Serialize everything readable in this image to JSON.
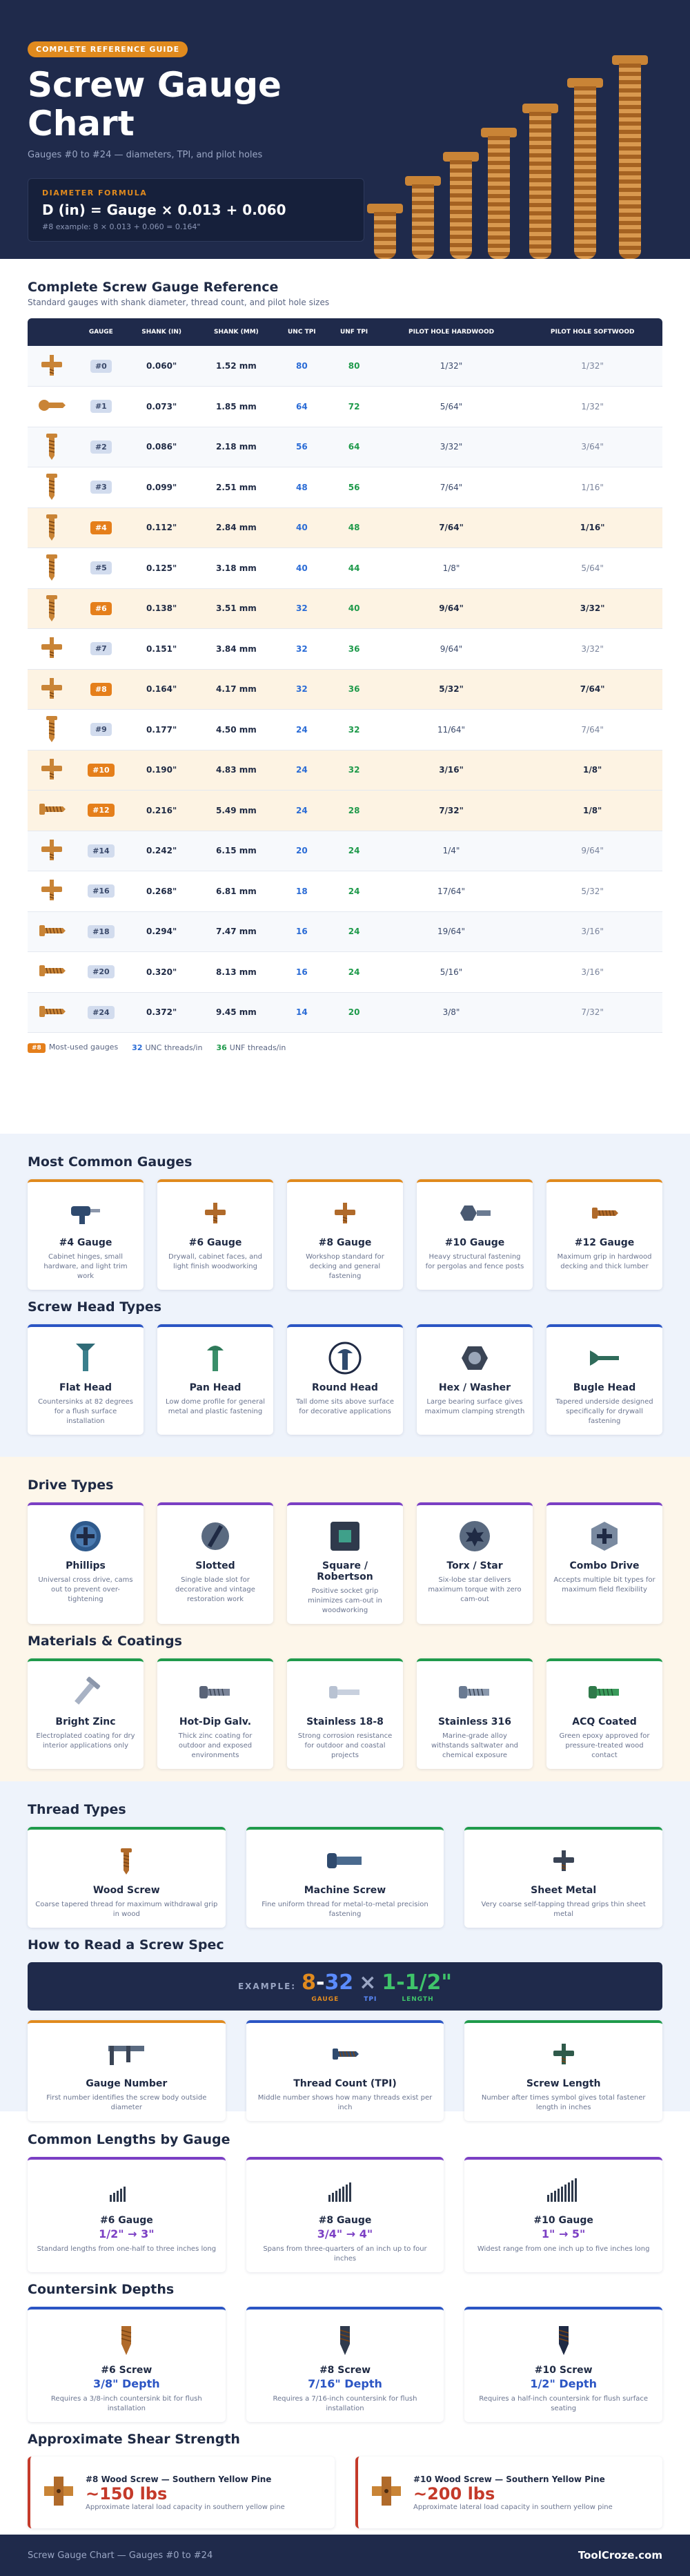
{
  "hero": {
    "tag": "COMPLETE REFERENCE GUIDE",
    "title": "Screw Gauge Chart",
    "subtitle": "Gauges #0 to #24 — diameters, TPI, and pilot holes",
    "formula_label": "DIAMETER FORMULA",
    "formula": "D (in) = Gauge × 0.013 + 0.060",
    "formula_example": "#8 example: 8 × 0.013 + 0.060 = 0.164\""
  },
  "table": {
    "title": "Complete Screw Gauge Reference",
    "subtitle": "Standard gauges with shank diameter, thread count, and pilot hole sizes",
    "headers": [
      "",
      "GAUGE",
      "SHANK (IN)",
      "SHANK (MM)",
      "UNC TPI",
      "UNF TPI",
      "PILOT HOLE HARDWOOD",
      "PILOT HOLE SOFTWOOD"
    ],
    "rows": [
      {
        "g": "#0",
        "in": "0.060\"",
        "mm": "1.52 mm",
        "unc": "80",
        "unf": "80",
        "hw": "1/32\"",
        "sw": "1/32\"",
        "hl": false,
        "icon": "phillips-screw"
      },
      {
        "g": "#1",
        "in": "0.073\"",
        "mm": "1.85 mm",
        "unc": "64",
        "unf": "72",
        "hw": "5/64\"",
        "sw": "1/32\"",
        "hl": false,
        "icon": "round-screw"
      },
      {
        "g": "#2",
        "in": "0.086\"",
        "mm": "2.18 mm",
        "unc": "56",
        "unf": "64",
        "hw": "3/32\"",
        "sw": "3/64\"",
        "hl": false,
        "icon": "wood-screw"
      },
      {
        "g": "#3",
        "in": "0.099\"",
        "mm": "2.51 mm",
        "unc": "48",
        "unf": "56",
        "hw": "7/64\"",
        "sw": "1/16\"",
        "hl": false,
        "icon": "wood-screw"
      },
      {
        "g": "#4",
        "in": "0.112\"",
        "mm": "2.84 mm",
        "unc": "40",
        "unf": "48",
        "hw": "7/64\"",
        "sw": "1/16\"",
        "hl": true,
        "icon": "wood-screw"
      },
      {
        "g": "#5",
        "in": "0.125\"",
        "mm": "3.18 mm",
        "unc": "40",
        "unf": "44",
        "hw": "1/8\"",
        "sw": "5/64\"",
        "hl": false,
        "icon": "wood-screw"
      },
      {
        "g": "#6",
        "in": "0.138\"",
        "mm": "3.51 mm",
        "unc": "32",
        "unf": "40",
        "hw": "9/64\"",
        "sw": "3/32\"",
        "hl": true,
        "icon": "wood-screw"
      },
      {
        "g": "#7",
        "in": "0.151\"",
        "mm": "3.84 mm",
        "unc": "32",
        "unf": "36",
        "hw": "9/64\"",
        "sw": "3/32\"",
        "hl": false,
        "icon": "phillips-screw"
      },
      {
        "g": "#8",
        "in": "0.164\"",
        "mm": "4.17 mm",
        "unc": "32",
        "unf": "36",
        "hw": "5/32\"",
        "sw": "7/64\"",
        "hl": true,
        "icon": "phillips-screw"
      },
      {
        "g": "#9",
        "in": "0.177\"",
        "mm": "4.50 mm",
        "unc": "24",
        "unf": "32",
        "hw": "11/64\"",
        "sw": "7/64\"",
        "hl": false,
        "icon": "wood-screw"
      },
      {
        "g": "#10",
        "in": "0.190\"",
        "mm": "4.83 mm",
        "unc": "24",
        "unf": "32",
        "hw": "3/16\"",
        "sw": "1/8\"",
        "hl": true,
        "icon": "phillips-screw"
      },
      {
        "g": "#12",
        "in": "0.216\"",
        "mm": "5.49 mm",
        "unc": "24",
        "unf": "28",
        "hw": "7/32\"",
        "sw": "1/8\"",
        "hl": true,
        "icon": "side-screw"
      },
      {
        "g": "#14",
        "in": "0.242\"",
        "mm": "6.15 mm",
        "unc": "20",
        "unf": "24",
        "hw": "1/4\"",
        "sw": "9/64\"",
        "hl": false,
        "icon": "phillips-screw"
      },
      {
        "g": "#16",
        "in": "0.268\"",
        "mm": "6.81 mm",
        "unc": "18",
        "unf": "24",
        "hw": "17/64\"",
        "sw": "5/32\"",
        "hl": false,
        "icon": "phillips-screw"
      },
      {
        "g": "#18",
        "in": "0.294\"",
        "mm": "7.47 mm",
        "unc": "16",
        "unf": "24",
        "hw": "19/64\"",
        "sw": "3/16\"",
        "hl": false,
        "icon": "side-screw"
      },
      {
        "g": "#20",
        "in": "0.320\"",
        "mm": "8.13 mm",
        "unc": "16",
        "unf": "24",
        "hw": "5/16\"",
        "sw": "3/16\"",
        "hl": false,
        "icon": "side-screw"
      },
      {
        "g": "#24",
        "in": "0.372\"",
        "mm": "9.45 mm",
        "unc": "14",
        "unf": "20",
        "hw": "3/8\"",
        "sw": "7/32\"",
        "hl": false,
        "icon": "side-screw"
      }
    ],
    "legend": {
      "k1": "#8",
      "t1": "Most-used gauges",
      "k2": "32",
      "t2": "UNC threads/in",
      "k3": "36",
      "t3": "UNF threads/in"
    }
  },
  "common": {
    "title": "Most Common Gauges",
    "cards": [
      {
        "t": "#4 Gauge",
        "d": "Cabinet hinges, small hardware, and light trim work",
        "icon": "drill-icon"
      },
      {
        "t": "#6 Gauge",
        "d": "Drywall, cabinet faces, and light finish woodworking",
        "icon": "phillips-screw-icon"
      },
      {
        "t": "#8 Gauge",
        "d": "Workshop standard for decking and general fastening",
        "icon": "phillips-screw-icon"
      },
      {
        "t": "#10 Gauge",
        "d": "Heavy structural fastening for pergolas and fence posts",
        "icon": "hex-bolt-icon"
      },
      {
        "t": "#12 Gauge",
        "d": "Maximum grip in hardwood decking and thick lumber",
        "icon": "side-screw-icon"
      }
    ]
  },
  "heads": {
    "title": "Screw Head Types",
    "cards": [
      {
        "t": "Flat Head",
        "d": "Countersinks at 82 degrees for a flush surface installation",
        "icon": "flat-head-icon"
      },
      {
        "t": "Pan Head",
        "d": "Low dome profile for general metal and plastic fastening",
        "icon": "pan-head-icon"
      },
      {
        "t": "Round Head",
        "d": "Tall dome sits above surface for decorative applications",
        "icon": "round-head-icon"
      },
      {
        "t": "Hex / Washer",
        "d": "Large bearing surface gives maximum clamping strength",
        "icon": "hex-washer-icon"
      },
      {
        "t": "Bugle Head",
        "d": "Tapered underside designed specifically for drywall fastening",
        "icon": "bugle-head-icon"
      }
    ]
  },
  "drives": {
    "title": "Drive Types",
    "cards": [
      {
        "t": "Phillips",
        "d": "Universal cross drive, cams out to prevent over-tightening",
        "icon": "phillips-drive-icon"
      },
      {
        "t": "Slotted",
        "d": "Single blade slot for decorative and vintage restoration work",
        "icon": "slotted-drive-icon"
      },
      {
        "t": "Square / Robertson",
        "d": "Positive socket grip minimizes cam-out in woodworking",
        "icon": "square-drive-icon"
      },
      {
        "t": "Torx / Star",
        "d": "Six-lobe star delivers maximum torque with zero cam-out",
        "icon": "torx-drive-icon"
      },
      {
        "t": "Combo Drive",
        "d": "Accepts multiple bit types for maximum field flexibility",
        "icon": "combo-drive-icon"
      }
    ]
  },
  "materials": {
    "title": "Materials & Coatings",
    "cards": [
      {
        "t": "Bright Zinc",
        "d": "Electroplated coating for dry interior applications only",
        "icon": "zinc-screw-icon"
      },
      {
        "t": "Hot-Dip Galv.",
        "d": "Thick zinc coating for outdoor and exposed environments",
        "icon": "galv-screw-icon"
      },
      {
        "t": "Stainless 18-8",
        "d": "Strong corrosion resistance for outdoor and coastal projects",
        "icon": "stainless-screw-icon"
      },
      {
        "t": "Stainless 316",
        "d": "Marine-grade alloy withstands saltwater and chemical exposure",
        "icon": "marine-screw-icon"
      },
      {
        "t": "ACQ Coated",
        "d": "Green epoxy approved for pressure-treated wood contact",
        "icon": "acq-screw-icon"
      }
    ]
  },
  "threads": {
    "title": "Thread Types",
    "cards": [
      {
        "t": "Wood Screw",
        "d": "Coarse tapered thread for maximum withdrawal grip in wood",
        "icon": "wood-screw-icon"
      },
      {
        "t": "Machine Screw",
        "d": "Fine uniform thread for metal-to-metal precision fastening",
        "icon": "machine-screw-icon"
      },
      {
        "t": "Sheet Metal",
        "d": "Very coarse self-tapping thread grips thin sheet metal",
        "icon": "sheet-metal-screw-icon"
      }
    ]
  },
  "spec": {
    "title": "How to Read a Screw Spec",
    "example_label": "EXAMPLE:",
    "gauge": "8",
    "dash": "-",
    "tpi": "32",
    "x": "×",
    "length": "1-1/2\"",
    "lbl_gauge": "GAUGE",
    "lbl_tpi": "TPI",
    "lbl_length": "LENGTH",
    "cards": [
      {
        "t": "Gauge Number",
        "d": "First number identifies the screw body outside diameter",
        "icon": "caliper-icon"
      },
      {
        "t": "Thread Count (TPI)",
        "d": "Middle number shows how many threads exist per inch",
        "icon": "thread-icon"
      },
      {
        "t": "Screw Length",
        "d": "Number after times symbol gives total fastener length in inches",
        "icon": "length-icon"
      }
    ]
  },
  "lengths": {
    "title": "Common Lengths by Gauge",
    "cards": [
      {
        "t": "#6 Gauge",
        "v": "1/2\" → 3\"",
        "d": "Standard lengths from one-half to three inches long"
      },
      {
        "t": "#8 Gauge",
        "v": "3/4\" → 4\"",
        "d": "Spans from three-quarters of an inch up to four inches"
      },
      {
        "t": "#10 Gauge",
        "v": "1\" → 5\"",
        "d": "Widest range from one inch up to five inches long"
      }
    ]
  },
  "countersink": {
    "title": "Countersink Depths",
    "cards": [
      {
        "t": "#6 Screw",
        "v": "3/8\" Depth",
        "d": "Requires a 3/8-inch countersink bit for flush installation"
      },
      {
        "t": "#8 Screw",
        "v": "7/16\" Depth",
        "d": "Requires a 7/16-inch countersink for flush installation"
      },
      {
        "t": "#10 Screw",
        "v": "1/2\" Depth",
        "d": "Requires a half-inch countersink for flush surface seating"
      }
    ]
  },
  "shear": {
    "title": "Approximate Shear Strength",
    "cards": [
      {
        "t": "#8 Wood Screw — Southern Yellow Pine",
        "v": "~150 lbs",
        "d": "Approximate lateral load capacity in southern yellow pine"
      },
      {
        "t": "#10 Wood Screw — Southern Yellow Pine",
        "v": "~200 lbs",
        "d": "Approximate lateral load capacity in southern yellow pine"
      }
    ]
  },
  "footer": {
    "left": "Screw Gauge Chart — Gauges #0 to #24",
    "right": "ToolCroze.com"
  }
}
